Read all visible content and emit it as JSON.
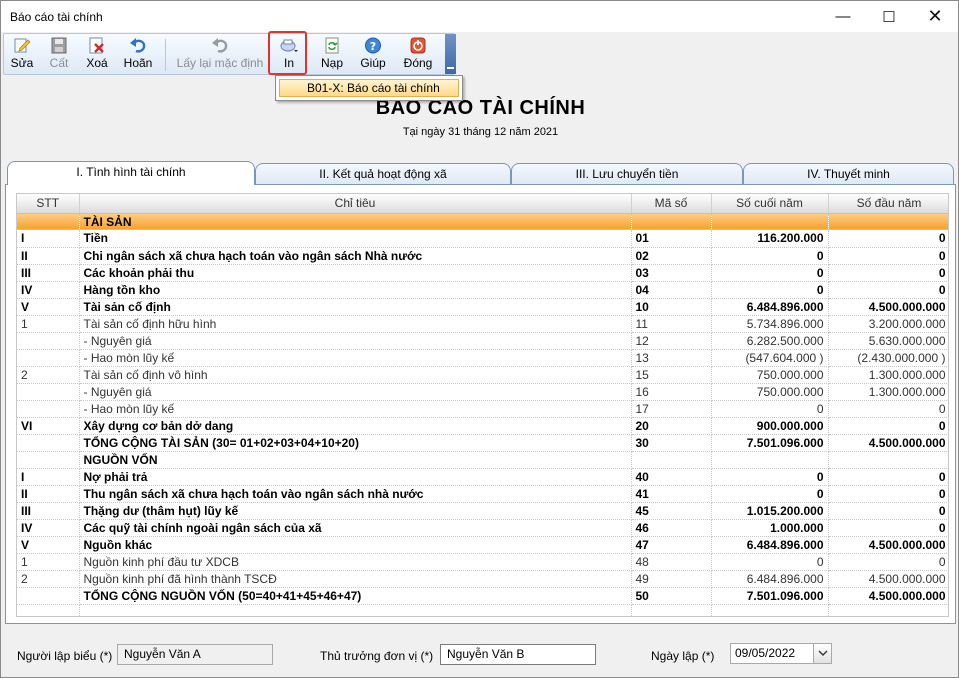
{
  "window": {
    "title": "Báo cáo tài chính",
    "minimize": "—",
    "maximize": "☐",
    "close": "✕"
  },
  "toolbar": {
    "buttons": [
      {
        "label": "Sửa",
        "icon": "edit-icon"
      },
      {
        "label": "Cất",
        "icon": "save-icon"
      },
      {
        "label": "Xoá",
        "icon": "delete-icon"
      },
      {
        "label": "Hoãn",
        "icon": "undo-icon"
      },
      {
        "label": "Lấy lại mặc định",
        "icon": "reset-icon"
      },
      {
        "label": "In",
        "icon": "print-icon"
      },
      {
        "label": "Nạp",
        "icon": "refresh-icon"
      },
      {
        "label": "Giúp",
        "icon": "help-icon"
      },
      {
        "label": "Đóng",
        "icon": "power-icon"
      }
    ]
  },
  "print_menu": {
    "items": [
      "B01-X: Báo cáo tài chính"
    ]
  },
  "report": {
    "title": "BÁO CÁO TÀI CHÍNH",
    "date_line": "Tại ngày 31 tháng 12 năm 2021"
  },
  "tabs": [
    "I. Tình hình tài chính",
    "II. Kết quả hoạt động xã",
    "III. Lưu chuyển tiền",
    "IV. Thuyết minh"
  ],
  "table": {
    "headers": [
      "STT",
      "Chỉ tiêu",
      "Mã số",
      "Số cuối năm",
      "Số đầu năm"
    ],
    "rows": [
      {
        "style": "grp",
        "cells": [
          "",
          "TÀI SẢN",
          "",
          "",
          ""
        ]
      },
      {
        "style": "bold",
        "cells": [
          "I",
          "Tiền",
          "01",
          "116.200.000",
          "0"
        ]
      },
      {
        "style": "bold",
        "cells": [
          "II",
          "Chi ngân sách xã chưa hạch toán vào ngân sách Nhà nước",
          "02",
          "0",
          "0"
        ]
      },
      {
        "style": "bold",
        "cells": [
          "III",
          "Các khoản phải thu",
          "03",
          "0",
          "0"
        ]
      },
      {
        "style": "bold",
        "cells": [
          "IV",
          "Hàng tồn kho",
          "04",
          "0",
          "0"
        ]
      },
      {
        "style": "bold",
        "cells": [
          "V",
          "Tài sản cố định",
          "10",
          "6.484.896.000",
          "4.500.000.000"
        ]
      },
      {
        "style": "norm",
        "cells": [
          "1",
          "Tài sản cố định hữu hình",
          "11",
          "5.734.896.000",
          "3.200.000.000"
        ]
      },
      {
        "style": "norm",
        "cells": [
          "",
          "- Nguyên giá",
          "12",
          "6.282.500.000",
          "5.630.000.000"
        ]
      },
      {
        "style": "norm",
        "cells": [
          "",
          "- Hao mòn lũy kế",
          "13",
          "(547.604.000 )",
          "(2.430.000.000 )"
        ]
      },
      {
        "style": "norm",
        "cells": [
          "2",
          "Tài sản cố định vô hình",
          "15",
          "750.000.000",
          "1.300.000.000"
        ]
      },
      {
        "style": "norm",
        "cells": [
          "",
          "- Nguyên giá",
          "16",
          "750.000.000",
          "1.300.000.000"
        ]
      },
      {
        "style": "norm",
        "cells": [
          "",
          "- Hao mòn lũy kế",
          "17",
          "0",
          "0"
        ]
      },
      {
        "style": "bold",
        "cells": [
          "VI",
          "Xây dựng cơ bản dở dang",
          "20",
          "900.000.000",
          "0"
        ]
      },
      {
        "style": "bold",
        "cells": [
          "",
          "TỔNG CỘNG TÀI SẢN (30= 01+02+03+04+10+20)",
          "30",
          "7.501.096.000",
          "4.500.000.000"
        ]
      },
      {
        "style": "bold",
        "cells": [
          "",
          "NGUỒN VỐN",
          "",
          "",
          ""
        ]
      },
      {
        "style": "bold",
        "cells": [
          "I",
          "Nợ phải trả",
          "40",
          "0",
          "0"
        ]
      },
      {
        "style": "bold",
        "cells": [
          "II",
          "Thu ngân sách xã chưa hạch toán vào ngân sách nhà nước",
          "41",
          "0",
          "0"
        ]
      },
      {
        "style": "bold",
        "cells": [
          "III",
          "Thặng dư (thâm hụt) lũy kế",
          "45",
          "1.015.200.000",
          "0"
        ]
      },
      {
        "style": "bold",
        "cells": [
          "IV",
          "Các quỹ tài chính ngoài ngân sách của xã",
          "46",
          "1.000.000",
          "0"
        ]
      },
      {
        "style": "bold",
        "cells": [
          "V",
          "Nguồn khác",
          "47",
          "6.484.896.000",
          "4.500.000.000"
        ]
      },
      {
        "style": "norm",
        "cells": [
          "1",
          "Nguồn kinh phí đầu tư XDCB",
          "48",
          "0",
          "0"
        ]
      },
      {
        "style": "norm",
        "cells": [
          "2",
          "Nguồn kinh phí đã hình thành TSCĐ",
          "49",
          "6.484.896.000",
          "4.500.000.000"
        ]
      },
      {
        "style": "bold",
        "cells": [
          "",
          "TỔNG CỘNG NGUỒN VỐN (50=40+41+45+46+47)",
          "50",
          "7.501.096.000",
          "4.500.000.000"
        ]
      },
      {
        "style": "norm",
        "cells": [
          "",
          "",
          "",
          "",
          ""
        ]
      }
    ]
  },
  "footer": {
    "preparer_label": "Người lập biểu (*)",
    "preparer_value": "Nguyễn Văn A",
    "head_label": "Thủ trưởng đơn vị (*)",
    "head_value": "Nguyễn Văn B",
    "date_label": "Ngày lập (*)",
    "date_value": "09/05/2022"
  }
}
